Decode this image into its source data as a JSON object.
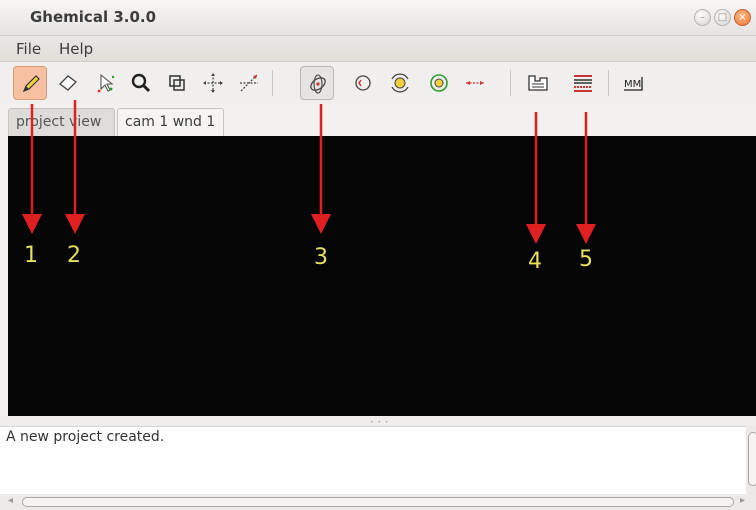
{
  "window": {
    "title": "Ghemical 3.0.0",
    "controls": [
      "–",
      "□",
      "×"
    ]
  },
  "menu": {
    "file": "File",
    "help": "Help"
  },
  "toolbar": {
    "tools": [
      {
        "icon": "pencil-draw-icon",
        "state": "active"
      },
      {
        "icon": "eraser-icon"
      },
      {
        "icon": "select-atoms-icon"
      },
      {
        "icon": "zoom-icon"
      },
      {
        "icon": "clipping-icon"
      },
      {
        "icon": "translate-xy-icon"
      },
      {
        "icon": "translate-z-icon"
      },
      {
        "icon": "orbit-xy-icon",
        "state": "pressed"
      },
      {
        "icon": "orbit-z-icon"
      },
      {
        "icon": "rotate-xy-icon"
      },
      {
        "icon": "rotate-z-icon"
      },
      {
        "icon": "measure-icon"
      },
      {
        "icon": "element-table-icon"
      },
      {
        "icon": "bond-type-icon"
      },
      {
        "icon": "molecular-mechanics-icon"
      }
    ],
    "mm_label": "MM"
  },
  "tabs": [
    {
      "label": "project view",
      "active": false
    },
    {
      "label": "cam 1 wnd 1",
      "active": true
    }
  ],
  "log": {
    "text": "A new project created."
  },
  "annotations": {
    "color": "#e02020",
    "label_color": "#e6e05a",
    "labels": [
      "1",
      "2",
      "3",
      "4",
      "5"
    ]
  }
}
